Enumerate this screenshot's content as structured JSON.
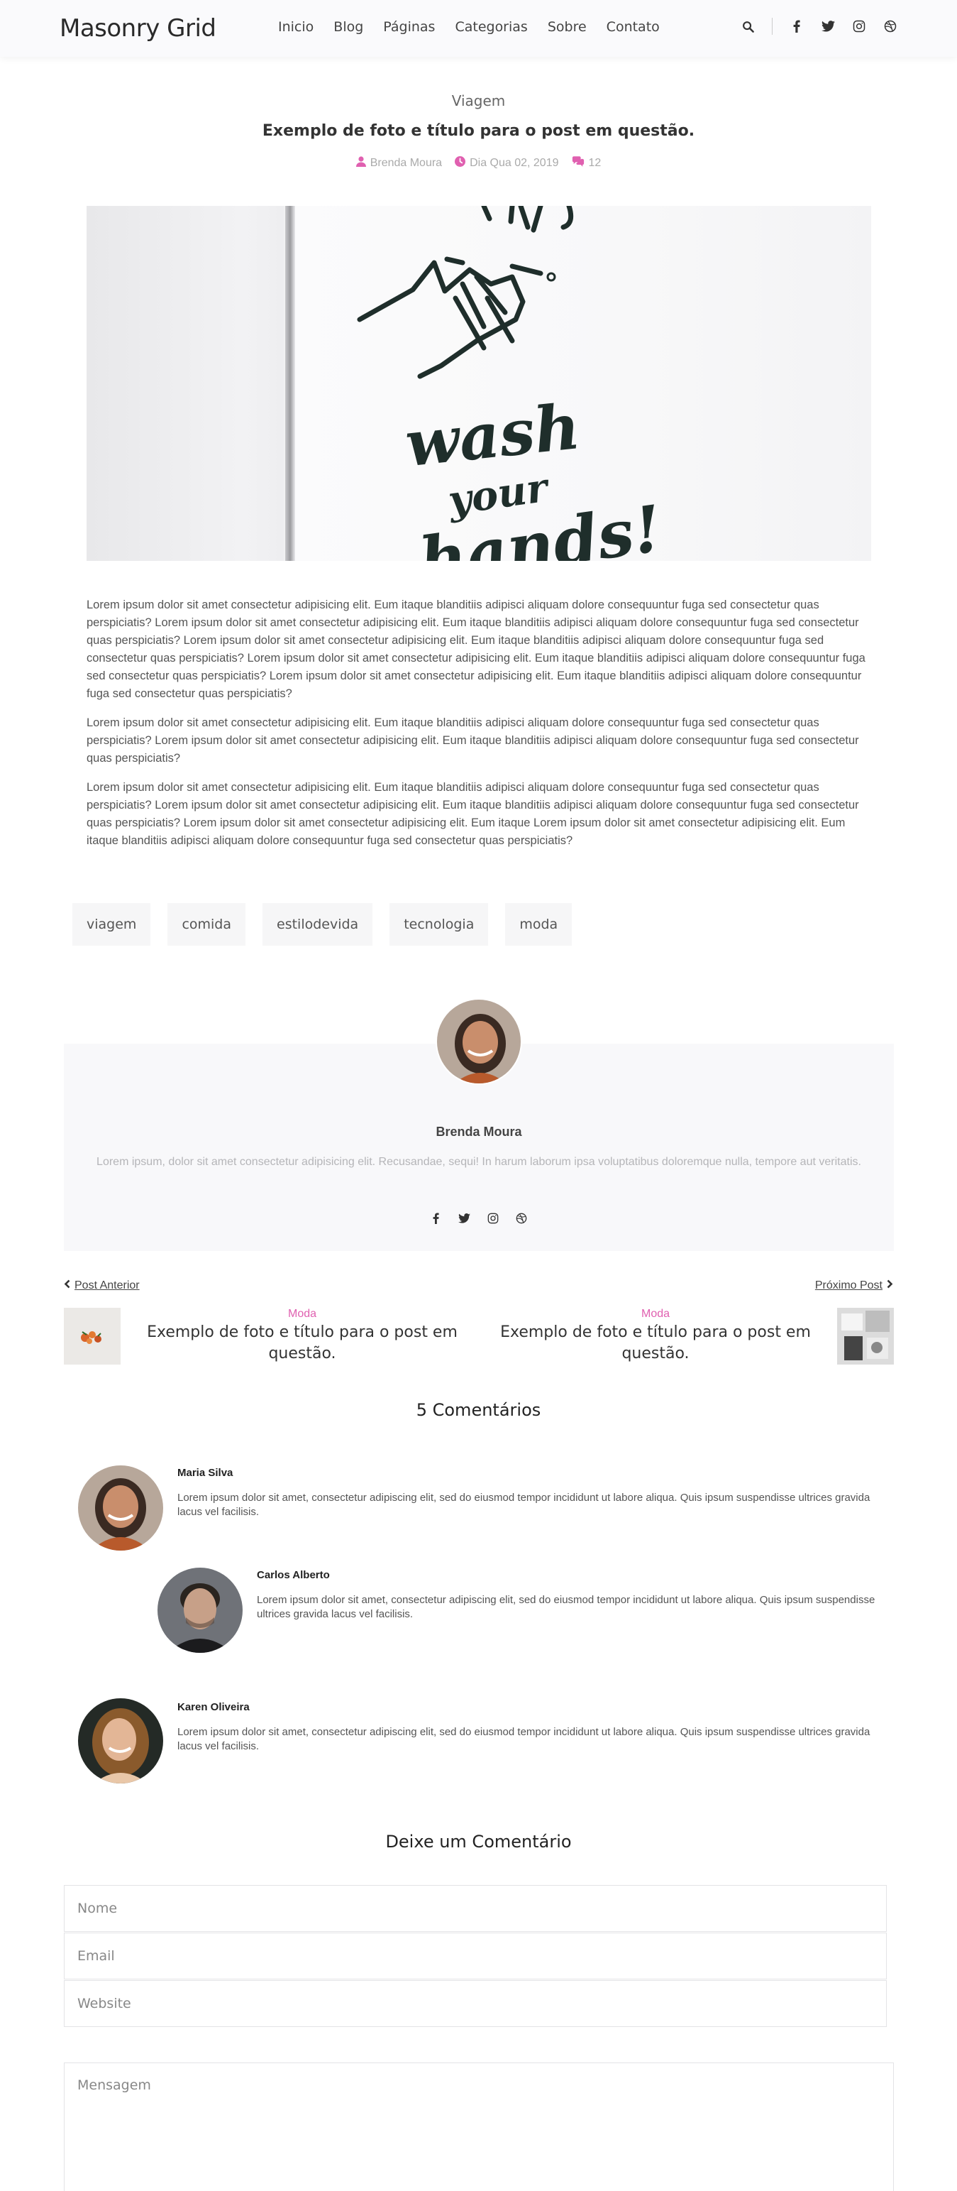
{
  "header": {
    "logo": "Masonry Grid",
    "nav": [
      "Inicio",
      "Blog",
      "Páginas",
      "Categorias",
      "Sobre",
      "Contato"
    ],
    "icons": [
      "search-icon",
      "facebook-icon",
      "twitter-icon",
      "instagram-icon",
      "dribbble-icon"
    ]
  },
  "post": {
    "category": "Viagem",
    "title": "Exemplo de foto e título para o post em questão.",
    "author": "Brenda Moura",
    "date": "Dia Qua 02, 2019",
    "comments_count": "12",
    "hero_text": [
      "wash",
      "your",
      "hands!"
    ],
    "paragraphs": [
      "Lorem ipsum dolor sit amet consectetur adipisicing elit. Eum itaque blanditiis adipisci aliquam dolore consequuntur fuga sed consectetur quas perspiciatis? Lorem ipsum dolor sit amet consectetur adipisicing elit. Eum itaque blanditiis adipisci aliquam dolore consequuntur fuga sed consectetur quas perspiciatis? Lorem ipsum dolor sit amet consectetur adipisicing elit. Eum itaque blanditiis adipisci aliquam dolore consequuntur fuga sed consectetur quas perspiciatis? Lorem ipsum dolor sit amet consectetur adipisicing elit. Eum itaque blanditiis adipisci aliquam dolore consequuntur fuga sed consectetur quas perspiciatis? Lorem ipsum dolor sit amet consectetur adipisicing elit. Eum itaque blanditiis adipisci aliquam dolore consequuntur fuga sed consectetur quas perspiciatis?",
      "Lorem ipsum dolor sit amet consectetur adipisicing elit. Eum itaque blanditiis adipisci aliquam dolore consequuntur fuga sed consectetur quas perspiciatis? Lorem ipsum dolor sit amet consectetur adipisicing elit. Eum itaque blanditiis adipisci aliquam dolore consequuntur fuga sed consectetur quas perspiciatis?",
      "Lorem ipsum dolor sit amet consectetur adipisicing elit. Eum itaque blanditiis adipisci aliquam dolore consequuntur fuga sed consectetur quas perspiciatis? Lorem ipsum dolor sit amet consectetur adipisicing elit. Eum itaque blanditiis adipisci aliquam dolore consequuntur fuga sed consectetur quas perspiciatis? Lorem ipsum dolor sit amet consectetur adipisicing elit. Eum itaque Lorem ipsum dolor sit amet consectetur adipisicing elit. Eum itaque blanditiis adipisci aliquam dolore consequuntur fuga sed consectetur quas perspiciatis?"
    ],
    "tags": [
      "viagem",
      "comida",
      "estilodevida",
      "tecnologia",
      "moda"
    ]
  },
  "author_box": {
    "name": "Brenda Moura",
    "bio": "Lorem ipsum, dolor sit amet consectetur adipisicing elit. Recusandae, sequi! In harum laborum ipsa voluptatibus doloremque nulla, tempore aut veritatis.",
    "social": [
      "facebook-icon",
      "twitter-icon",
      "instagram-icon",
      "dribbble-icon"
    ]
  },
  "post_nav": {
    "prev_label": "Post Anterior",
    "next_label": "Próximo Post",
    "prev": {
      "category": "Moda",
      "title": "Exemplo de foto e título para o post em questão."
    },
    "next": {
      "category": "Moda",
      "title": "Exemplo de foto e título para o post em questão."
    }
  },
  "comments": {
    "title": "5 Comentários",
    "items": [
      {
        "name": "Maria Silva",
        "text": "Lorem ipsum dolor sit amet, consectetur adipiscing elit, sed do eiusmod tempor incididunt ut labore aliqua. Quis ipsum suspendisse ultrices gravida lacus vel facilisis."
      },
      {
        "name": "Carlos Alberto",
        "text": "Lorem ipsum dolor sit amet, consectetur adipiscing elit, sed do eiusmod tempor incididunt ut labore aliqua. Quis ipsum suspendisse ultrices gravida lacus vel facilisis."
      },
      {
        "name": "Karen Oliveira",
        "text": "Lorem ipsum dolor sit amet, consectetur adipiscing elit, sed do eiusmod tempor incididunt ut labore aliqua. Quis ipsum suspendisse ultrices gravida lacus vel facilisis."
      }
    ]
  },
  "form": {
    "title": "Deixe um Comentário",
    "name_placeholder": "Nome",
    "email_placeholder": "Email",
    "website_placeholder": "Website",
    "message_placeholder": "Mensagem"
  },
  "colors": {
    "accent": "#e060b0"
  }
}
